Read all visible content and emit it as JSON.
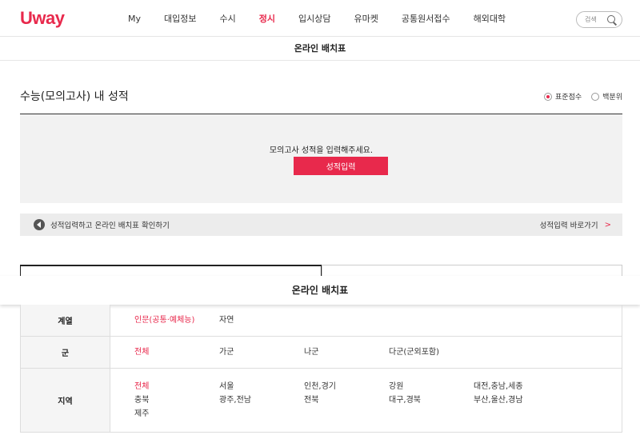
{
  "header": {
    "logo": "Uway",
    "nav": [
      "My",
      "대입정보",
      "수시",
      "정시",
      "입시상담",
      "유마켓",
      "공통원서접수",
      "해외대학"
    ],
    "active_nav_index": 3,
    "search_label": "검색"
  },
  "subheader": {
    "title": "온라인 배치표"
  },
  "score_section": {
    "title": "수능(모의고사) 내 성적",
    "radio_options": [
      "표준점수",
      "백분위"
    ],
    "selected_radio": "표준점수",
    "message": "모의고사 성적을 입력해주세요.",
    "button_label": "성적입력"
  },
  "notice": {
    "text": "성적입력하고 온라인 배치표 확인하기",
    "link_label": "성적입력 바로가기"
  },
  "sticky": {
    "title": "온라인 배치표"
  },
  "filters": {
    "track": {
      "label": "계열",
      "options": [
        "인문(공통·예체능)",
        "자연"
      ],
      "selected": "인문(공통·예체능)"
    },
    "group": {
      "label": "군",
      "options": [
        "전체",
        "가군",
        "나군",
        "다군(군외포함)"
      ],
      "selected": "전체"
    },
    "region": {
      "label": "지역",
      "options": [
        "전체",
        "서울",
        "인천,경기",
        "강원",
        "대전,충남,세종",
        "충북",
        "광주,전남",
        "전북",
        "대구,경북",
        "부산,울산,경남",
        "제주"
      ],
      "selected": "전체"
    }
  },
  "colors": {
    "accent": "#e8294c"
  }
}
